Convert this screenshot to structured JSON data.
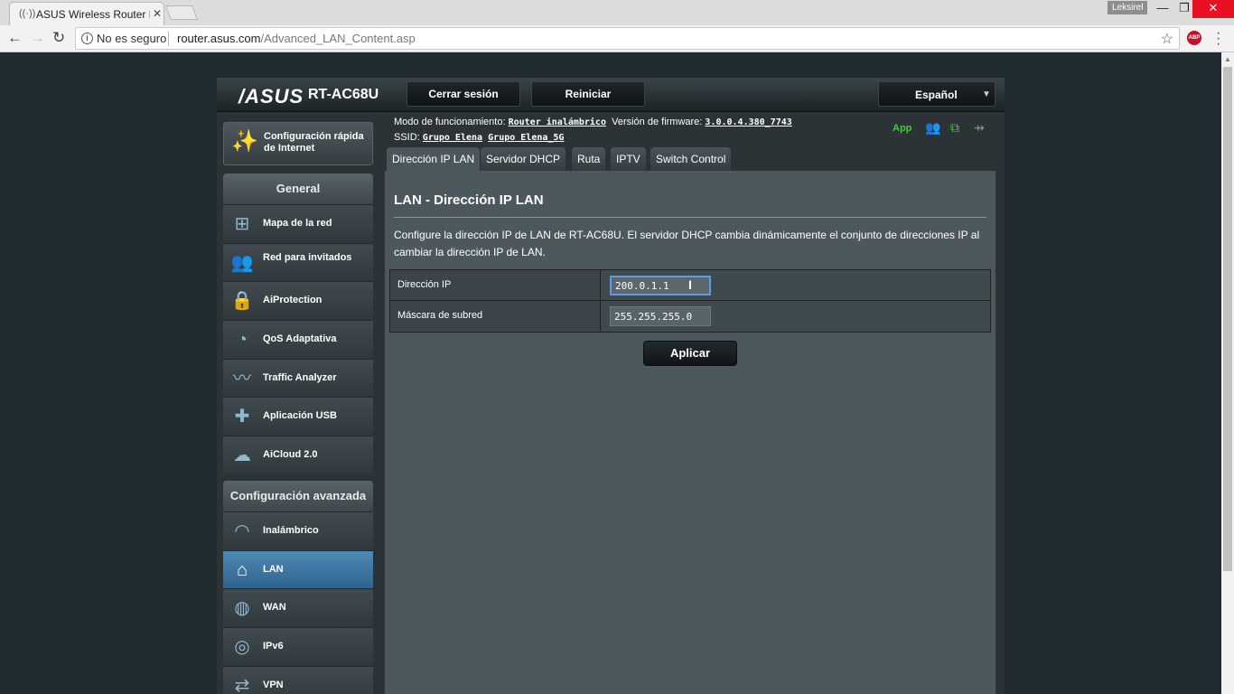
{
  "browser": {
    "tab_title": "ASUS Wireless Router RT",
    "profile": "Leksirel",
    "security_label": "No es seguro",
    "url_host": "router.asus.com",
    "url_path": "/Advanced_LAN_Content.asp"
  },
  "header": {
    "brand": "/ASUS",
    "model": "RT-AC68U",
    "logout_label": "Cerrar sesión",
    "reboot_label": "Reiniciar",
    "language": "Español"
  },
  "quick_setup": {
    "label": "Configuración rápida de Internet"
  },
  "sidebar": {
    "general_title": "General",
    "general_items": [
      {
        "label": "Mapa de la red",
        "icon": "network-map-icon"
      },
      {
        "label": "Red para invitados",
        "icon": "guest-network-icon"
      },
      {
        "label": "AiProtection",
        "icon": "lock-icon"
      },
      {
        "label": "QoS Adaptativa",
        "icon": "speedometer-icon"
      },
      {
        "label": "Traffic Analyzer",
        "icon": "traffic-graph-icon"
      },
      {
        "label": "Aplicación USB",
        "icon": "puzzle-icon"
      },
      {
        "label": "AiCloud 2.0",
        "icon": "cloud-house-icon"
      }
    ],
    "advanced_title": "Configuración avanzada",
    "advanced_items": [
      {
        "label": "Inalámbrico",
        "icon": "wifi-icon"
      },
      {
        "label": "LAN",
        "icon": "home-icon"
      },
      {
        "label": "WAN",
        "icon": "globe-icon"
      },
      {
        "label": "IPv6",
        "icon": "ipv6-globe-icon"
      },
      {
        "label": "VPN",
        "icon": "vpn-icon"
      }
    ]
  },
  "status": {
    "mode_label": "Modo de funcionamiento:",
    "mode_value": "Router inalámbrico",
    "firmware_label": "Versión de firmware:",
    "firmware_value": "3.0.0.4.380_7743",
    "ssid_label": "SSID:",
    "ssid_1": "Grupo Elena",
    "ssid_2": "Grupo Elena_5G",
    "app_label": "App"
  },
  "tabs": [
    "Dirección IP LAN",
    "Servidor DHCP",
    "Ruta",
    "IPTV",
    "Switch Control"
  ],
  "content": {
    "title": "LAN - Dirección IP LAN",
    "description": "Configure la dirección IP de LAN de RT-AC68U. El servidor DHCP cambia dinámicamente el conjunto de direcciones IP al cambiar la dirección IP de LAN.",
    "ip_label": "Dirección IP",
    "ip_value": "200.0.1.1",
    "mask_label": "Máscara de subred",
    "mask_value": "255.255.255.0",
    "apply_label": "Aplicar"
  }
}
